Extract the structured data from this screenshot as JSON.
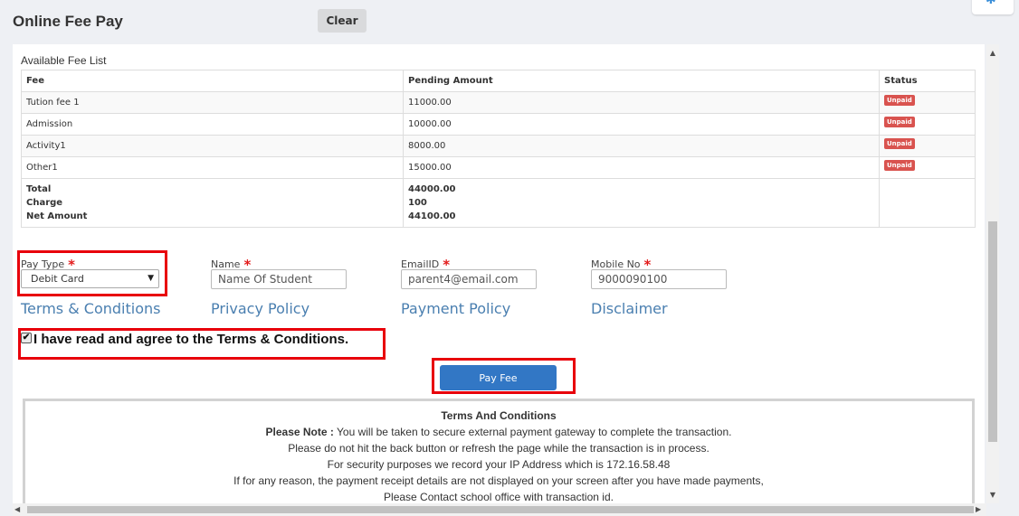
{
  "header": {
    "title": "Online Fee Pay",
    "clear_label": "Clear",
    "settings_icon": "gear-icon"
  },
  "fee_list": {
    "title": "Available Fee List",
    "columns": [
      "Fee",
      "Pending Amount",
      "Status"
    ],
    "rows": [
      {
        "fee": "Tution fee 1",
        "amount": "11000.00",
        "status": "Unpaid"
      },
      {
        "fee": "Admission",
        "amount": "10000.00",
        "status": "Unpaid"
      },
      {
        "fee": "Activity1",
        "amount": "8000.00",
        "status": "Unpaid"
      },
      {
        "fee": "Other1",
        "amount": "15000.00",
        "status": "Unpaid"
      }
    ],
    "totals": {
      "total_label": "Total",
      "charge_label": "Charge",
      "net_label": "Net Amount",
      "total_value": "44000.00",
      "charge_value": "100",
      "net_value": "44100.00"
    }
  },
  "form": {
    "pay_type_label": "Pay Type",
    "pay_type_value": "Debit Card",
    "name_label": "Name",
    "name_placeholder": "Name Of Student",
    "email_label": "EmailID",
    "email_value": "parent4@email.com",
    "mobile_label": "Mobile No",
    "mobile_value": "9000090100",
    "required_mark": "*"
  },
  "links": {
    "terms": "Terms & Conditions",
    "privacy": "Privacy Policy",
    "payment": "Payment Policy",
    "disclaimer": "Disclaimer"
  },
  "agree_text": "I have read and agree to the Terms & Conditions.",
  "pay_button": "Pay Fee",
  "terms_box": {
    "title": "Terms And Conditions",
    "note_label": "Please Note :",
    "note_text": " You will be taken to secure external payment gateway to complete the transaction.",
    "line2": "Please do not hit the back button or refresh the page while the transaction is in process.",
    "line3": "For security purposes we record your IP Address which is 172.16.58.48",
    "line4": "If for any reason, the payment receipt details are not displayed on your screen after you have made payments,",
    "line5": "Please Contact school office with transaction id."
  },
  "colors": {
    "accent": "#3277c5",
    "badge": "#d9534f",
    "highlight": "#e8000b",
    "link": "#4a7fb0"
  }
}
